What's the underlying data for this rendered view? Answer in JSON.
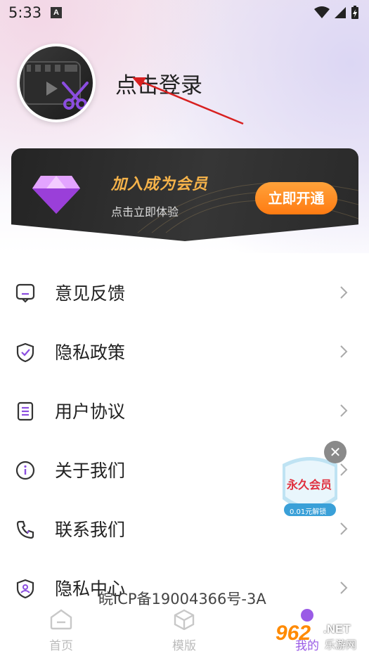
{
  "status_bar": {
    "time": "5:33",
    "a_badge": "A"
  },
  "profile": {
    "login_prompt": "点击登录"
  },
  "vip_card": {
    "title": "加入成为会员",
    "subtitle": "点击立即体验",
    "button": "立即开通",
    "accent": "#ff8a16"
  },
  "menu": {
    "items": [
      {
        "label": "意见反馈",
        "icon": "feedback-icon"
      },
      {
        "label": "隐私政策",
        "icon": "shield-check-icon"
      },
      {
        "label": "用户协议",
        "icon": "document-icon"
      },
      {
        "label": "关于我们",
        "icon": "info-icon"
      },
      {
        "label": "联系我们",
        "icon": "phone-icon"
      },
      {
        "label": "隐私中心",
        "icon": "privacy-user-icon"
      }
    ]
  },
  "promo": {
    "title": "永久会员",
    "sub": "0.01元解锁"
  },
  "footer": {
    "icp": "皖ICP备19004366号-3A"
  },
  "tabbar": {
    "tabs": [
      {
        "label": "首页"
      },
      {
        "label": "模版"
      },
      {
        "label": "我的"
      }
    ]
  },
  "watermark": {
    "num": "962",
    "net": ".NET",
    "cn": "乐游网"
  }
}
